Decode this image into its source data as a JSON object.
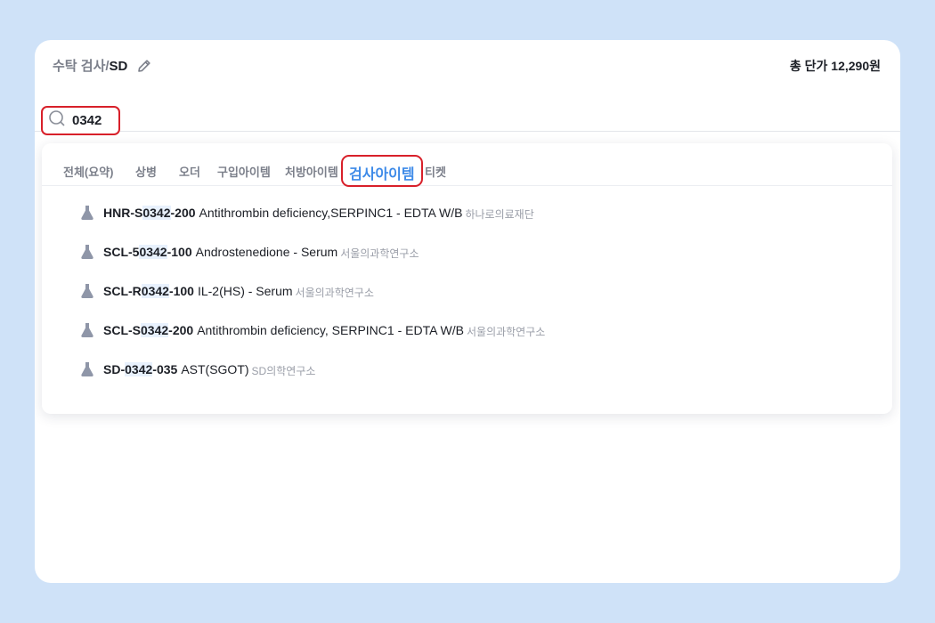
{
  "header": {
    "title_prefix": "수탁 검사/",
    "title_suffix": "SD",
    "price_label": "총 단가 12,290원"
  },
  "search": {
    "value": "0342",
    "icon": "search-icon"
  },
  "tabs": [
    {
      "label": "전체(요약)",
      "active": false
    },
    {
      "label": "상병",
      "active": false
    },
    {
      "label": "오더",
      "active": false
    },
    {
      "label": "구입아이템",
      "active": false
    },
    {
      "label": "처방아이템",
      "active": false
    },
    {
      "label": "검사아이템",
      "active": true
    },
    {
      "label": "티켓",
      "active": false
    }
  ],
  "results": [
    {
      "code_pre": "HNR-S",
      "code_match": "0342",
      "code_post": "-200",
      "name": "Antithrombin deficiency,SERPINC1 - EDTA W/B",
      "lab": "하나로의료재단"
    },
    {
      "code_pre": "SCL-5",
      "code_match": "0342",
      "code_post": "-100",
      "name": "Androstenedione - Serum",
      "lab": "서울의과학연구소"
    },
    {
      "code_pre": "SCL-R",
      "code_match": "0342",
      "code_post": "-100",
      "name": "IL-2(HS) - Serum",
      "lab": "서울의과학연구소"
    },
    {
      "code_pre": "SCL-S",
      "code_match": "0342",
      "code_post": "-200",
      "name": "Antithrombin deficiency, SERPINC1 - EDTA W/B",
      "lab": "서울의과학연구소"
    },
    {
      "code_pre": "SD-",
      "code_match": "0342",
      "code_post": "-035",
      "name": "AST(SGOT)",
      "lab": "SD의학연구소"
    }
  ],
  "colors": {
    "background": "#cfe2f8",
    "accent": "#3d8ae8",
    "highlight_border": "#d8202a",
    "match_highlight": "#e8f1fd"
  }
}
